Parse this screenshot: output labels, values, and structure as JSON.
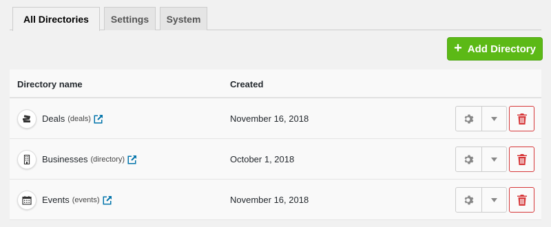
{
  "tabs": [
    {
      "label": "All Directories",
      "active": true
    },
    {
      "label": "Settings",
      "active": false
    },
    {
      "label": "System",
      "active": false
    }
  ],
  "add_button": {
    "label": "Add Directory",
    "icon": "plus-icon",
    "color": "#5cb916"
  },
  "table": {
    "columns": [
      "Directory name",
      "Created"
    ],
    "rows": [
      {
        "name": "Deals",
        "slug": "(deals)",
        "created": "November 16, 2018",
        "icon": "deals-icon"
      },
      {
        "name": "Businesses",
        "slug": "(directory)",
        "created": "October 1, 2018",
        "icon": "building-icon"
      },
      {
        "name": "Events",
        "slug": "(events)",
        "created": "November 16, 2018",
        "icon": "calendar-icon"
      }
    ]
  },
  "colors": {
    "link": "#0073aa",
    "delete": "#d63638",
    "accent": "#5cb916"
  }
}
